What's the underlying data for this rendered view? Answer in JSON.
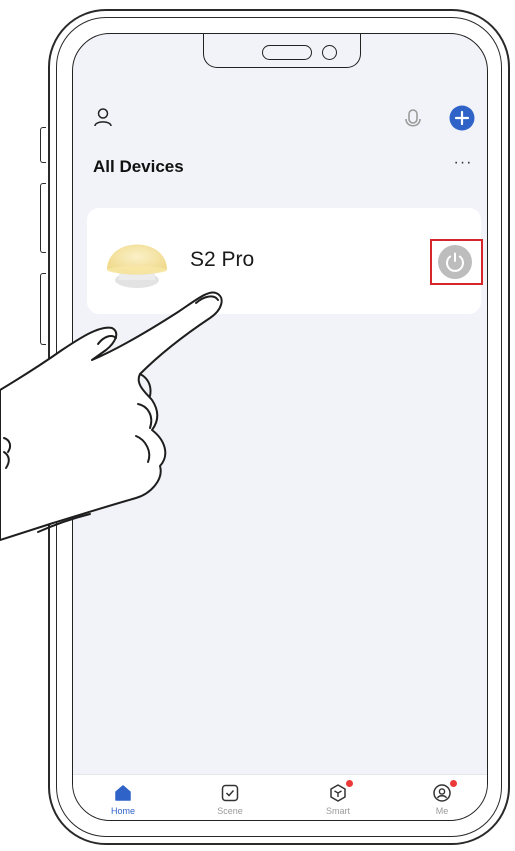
{
  "header": {
    "title": "All Devices",
    "profile_icon": "person-outline-icon",
    "mic_icon": "microphone-icon",
    "add_icon": "plus-circle-icon",
    "more_label": "···"
  },
  "devices": [
    {
      "name": "S2 Pro",
      "icon": "mushroom-lamp-image",
      "power_icon": "power-icon"
    }
  ],
  "colors": {
    "accent": "#2f63c8",
    "highlight": "#d6262b",
    "power_button": "#bdbdbd",
    "background": "#f2f3f8",
    "badge": "#ec3a3a"
  },
  "tabs": [
    {
      "label": "Home",
      "icon": "home-icon",
      "active": true
    },
    {
      "label": "Scene",
      "icon": "checkbox-icon",
      "active": false
    },
    {
      "label": "Smart",
      "icon": "cube-icon",
      "active": false,
      "badge": true
    },
    {
      "label": "Me",
      "icon": "user-circle-icon",
      "active": false,
      "badge": true
    }
  ]
}
